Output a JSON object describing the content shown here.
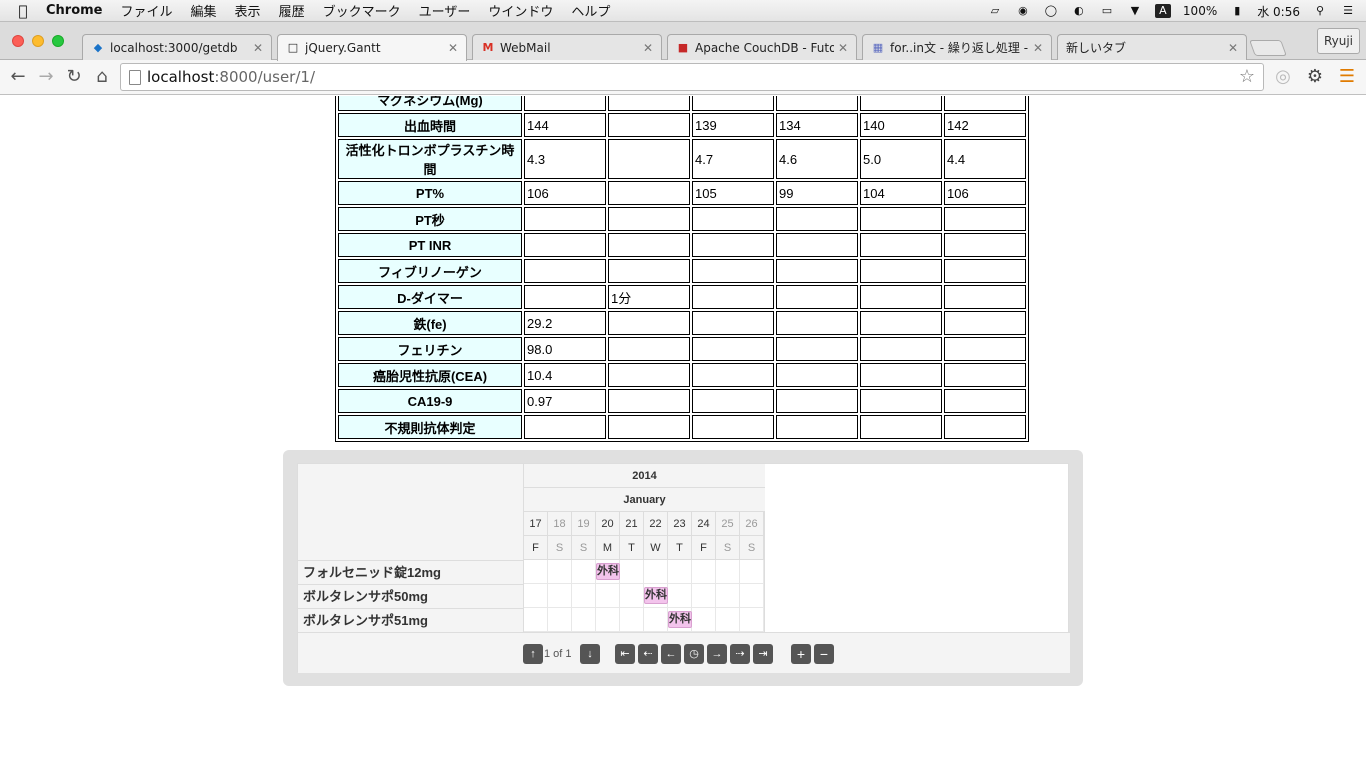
{
  "menubar": {
    "app": "Chrome",
    "items": [
      "ファイル",
      "編集",
      "表示",
      "履歴",
      "ブックマーク",
      "ユーザー",
      "ウインドウ",
      "ヘルプ"
    ],
    "battery": "100%",
    "clock": "水 0:56",
    "input_mode": "A"
  },
  "tabs": [
    {
      "title": "localhost:3000/getdb",
      "icon": "diamond-favicon",
      "active": false
    },
    {
      "title": "jQuery.Gantt",
      "icon": "page-favicon",
      "active": true
    },
    {
      "title": "WebMail",
      "icon": "gmail-favicon",
      "active": false
    },
    {
      "title": "Apache CouchDB - Futon:",
      "icon": "couchdb-favicon",
      "active": false
    },
    {
      "title": "for..in文 - 繰り返し処理 - Ja",
      "icon": "grid-favicon",
      "active": false
    },
    {
      "title": "新しいタブ",
      "icon": "",
      "active": false
    }
  ],
  "profile_name": "Ryuji",
  "address": {
    "host": "localhost",
    "rest": ":8000/user/1/"
  },
  "lab_table": {
    "rows": [
      {
        "label": "マグネシウム(Mg)",
        "values": [
          "",
          "",
          "",
          "",
          "",
          ""
        ]
      },
      {
        "label": "出血時間",
        "values": [
          "144",
          "",
          "139",
          "134",
          "140",
          "142"
        ]
      },
      {
        "label": "活性化トロンボプラスチン時間",
        "values": [
          "4.3",
          "",
          "4.7",
          "4.6",
          "5.0",
          "4.4"
        ]
      },
      {
        "label": "PT%",
        "values": [
          "106",
          "",
          "105",
          "99",
          "104",
          "106"
        ]
      },
      {
        "label": "PT秒",
        "values": [
          "",
          "",
          "",
          "",
          "",
          ""
        ]
      },
      {
        "label": "PT INR",
        "values": [
          "",
          "",
          "",
          "",
          "",
          ""
        ]
      },
      {
        "label": "フィブリノーゲン",
        "values": [
          "",
          "",
          "",
          "",
          "",
          ""
        ]
      },
      {
        "label": "D-ダイマー",
        "values": [
          "",
          "1分",
          "",
          "",
          "",
          ""
        ]
      },
      {
        "label": "鉄(fe)",
        "values": [
          "29.2",
          "",
          "",
          "",
          "",
          ""
        ]
      },
      {
        "label": "フェリチン",
        "values": [
          "98.0",
          "",
          "",
          "",
          "",
          ""
        ]
      },
      {
        "label": "癌胎児性抗原(CEA)",
        "values": [
          "10.4",
          "",
          "",
          "",
          "",
          ""
        ]
      },
      {
        "label": "CA19-9",
        "values": [
          "0.97",
          "",
          "",
          "",
          "",
          ""
        ]
      },
      {
        "label": "不規則抗体判定",
        "values": [
          "",
          "",
          "",
          "",
          "",
          ""
        ]
      }
    ]
  },
  "gantt": {
    "year": "2014",
    "month": "January",
    "days": [
      {
        "num": "17",
        "dow": "F",
        "weekend": false
      },
      {
        "num": "18",
        "dow": "S",
        "weekend": true
      },
      {
        "num": "19",
        "dow": "S",
        "weekend": true
      },
      {
        "num": "20",
        "dow": "M",
        "weekend": false
      },
      {
        "num": "21",
        "dow": "T",
        "weekend": false
      },
      {
        "num": "22",
        "dow": "W",
        "weekend": false
      },
      {
        "num": "23",
        "dow": "T",
        "weekend": false
      },
      {
        "num": "24",
        "dow": "F",
        "weekend": false
      },
      {
        "num": "25",
        "dow": "S",
        "weekend": true
      },
      {
        "num": "26",
        "dow": "S",
        "weekend": true
      }
    ],
    "tasks": [
      {
        "name": "フォルセニッド錠12mg",
        "bar_label": "外科",
        "start_day": "20"
      },
      {
        "name": "ボルタレンサポ50mg",
        "bar_label": "外科",
        "start_day": "22"
      },
      {
        "name": "ボルタレンサポ51mg",
        "bar_label": "外科",
        "start_day": "23"
      }
    ],
    "page_info": "1 of 1",
    "bar_color": "#f3c4ec"
  }
}
